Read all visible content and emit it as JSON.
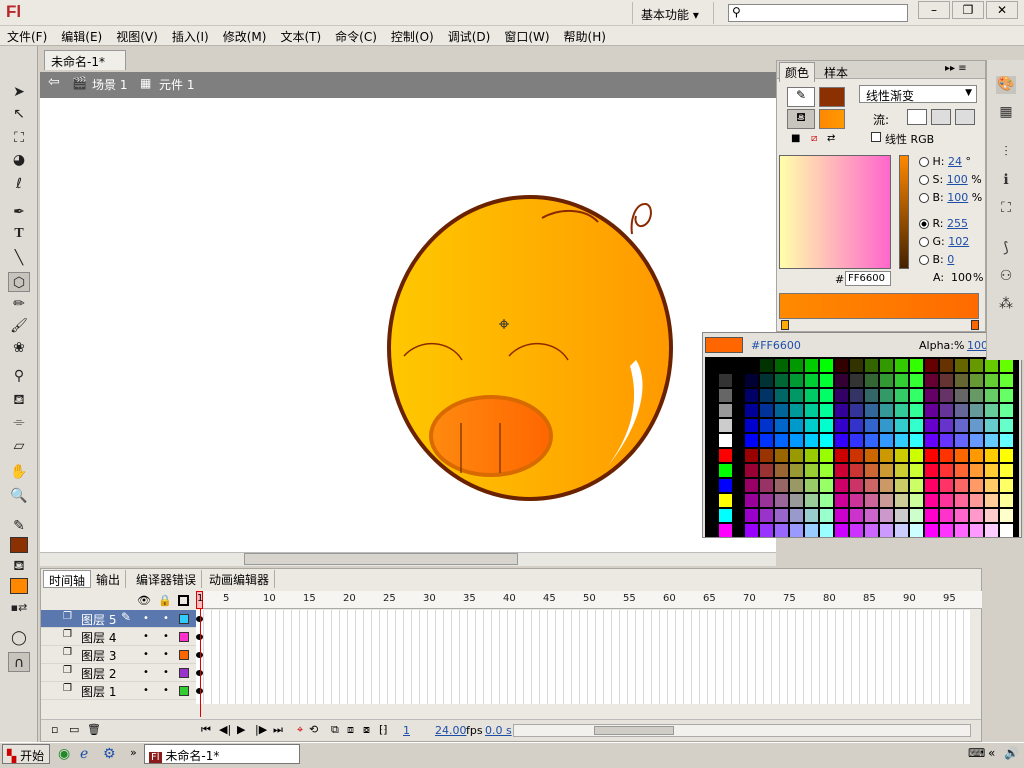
{
  "app": {
    "logo": "Fl",
    "workspace": "基本功能 ▾",
    "search_placeholder": ""
  },
  "window_buttons": [
    "–",
    "❐",
    "✕"
  ],
  "menus": [
    "文件(F)",
    "编辑(E)",
    "视图(V)",
    "插入(I)",
    "修改(M)",
    "文本(T)",
    "命令(C)",
    "控制(O)",
    "调试(D)",
    "窗口(W)",
    "帮助(H)"
  ],
  "document": {
    "tab": "未命名-1*",
    "close": "×"
  },
  "breadcrumb": {
    "back": "⇦",
    "scene": "场景 1",
    "symbol": "元件 1"
  },
  "color_panel": {
    "tabs": [
      "颜色",
      "样本"
    ],
    "fill_type": "线性渐变",
    "flow_label": "流:",
    "linear_rgb": "线性 RGB",
    "hsb": [
      {
        "label": "H:",
        "value": "24",
        "unit": "°"
      },
      {
        "label": "S:",
        "value": "100",
        "unit": "%"
      },
      {
        "label": "B:",
        "value": "100",
        "unit": "%"
      }
    ],
    "rgb": [
      {
        "label": "R:",
        "value": "255"
      },
      {
        "label": "G:",
        "value": "102"
      },
      {
        "label": "B:",
        "value": "0"
      }
    ],
    "hex_label": "#",
    "hex_value": "FF6600",
    "alpha_label": "A:",
    "alpha_value": "100",
    "alpha_unit": "%",
    "stroke_color": "#8b3000",
    "fill_color": "#ff8800"
  },
  "swatch_popup": {
    "hex": "#FF6600",
    "alpha_label": "Alpha:%",
    "alpha_value": "100",
    "preview_color": "#ff6600"
  },
  "timeline": {
    "tabs": [
      "时间轴",
      "输出",
      "编译器错误",
      "动画编辑器"
    ],
    "ticks": [
      "5",
      "10",
      "15",
      "20",
      "25",
      "30",
      "35",
      "40",
      "45",
      "50",
      "55",
      "60",
      "65",
      "70",
      "75",
      "80",
      "85",
      "90",
      "95"
    ],
    "playhead": "1",
    "layers": [
      {
        "name": "图层 5",
        "color": "#33ccff"
      },
      {
        "name": "图层 4",
        "color": "#ff33cc"
      },
      {
        "name": "图层 3",
        "color": "#ff6600"
      },
      {
        "name": "图层 2",
        "color": "#9933cc"
      },
      {
        "name": "图层 1",
        "color": "#33cc33"
      }
    ],
    "current_frame": "1",
    "fps": "24.00",
    "fps_unit": "fps",
    "elapsed": "0.0 s"
  },
  "taskbar": {
    "start": "开始",
    "item": "未命名-1*",
    "item_icon": "Fl"
  }
}
